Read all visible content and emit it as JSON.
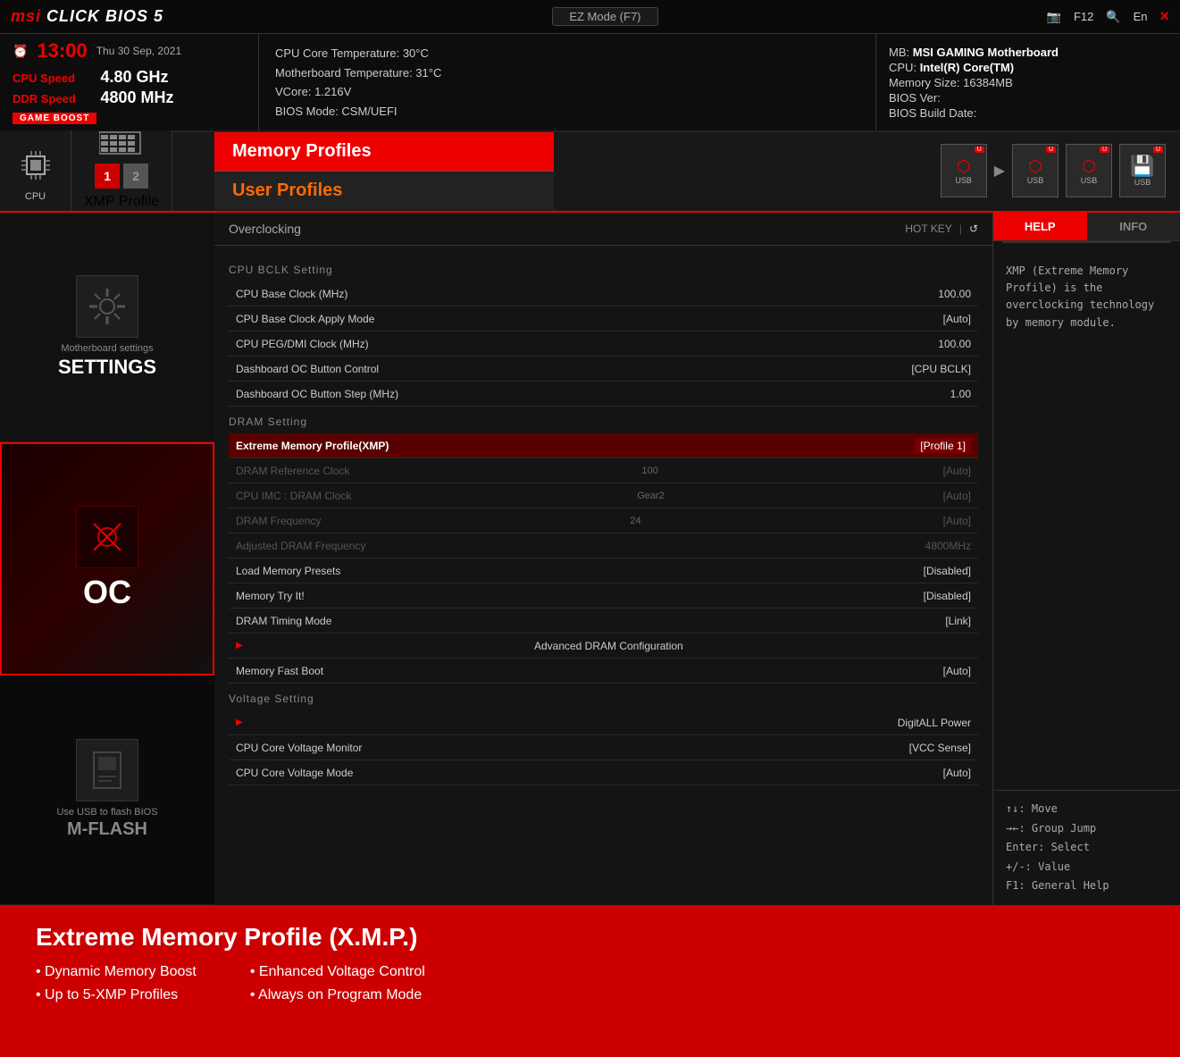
{
  "topbar": {
    "logo": "MSI CLICK BIOS 5",
    "ez_mode": "EZ Mode (F7)",
    "f12": "F12",
    "lang": "En",
    "close": "×"
  },
  "infobar": {
    "clock_symbol": "⏰",
    "time": "13:00",
    "date": "Thu 30 Sep, 2021",
    "cpu_speed_label": "CPU Speed",
    "cpu_speed_val": "4.80 GHz",
    "ddr_speed_label": "DDR Speed",
    "ddr_speed_val": "4800 MHz",
    "game_boost": "GAME BOOST",
    "mid": [
      "CPU Core Temperature: 30°C",
      "Motherboard Temperature: 31°C",
      "VCore: 1.216V",
      "BIOS Mode: CSM/UEFI"
    ],
    "right": {
      "mb_label": "MB:",
      "mb_val": "MSI GAMING Motherboard",
      "cpu_label": "CPU:",
      "cpu_val": "Intel(R) Core(TM)",
      "mem_label": "Memory Size:",
      "mem_val": "16384MB",
      "bios_ver_label": "BIOS Ver:",
      "bios_ver_val": "",
      "bios_build_label": "BIOS Build Date:",
      "bios_build_val": ""
    }
  },
  "nav": {
    "tabs": [
      {
        "id": "cpu",
        "icon": "🖥",
        "label": "CPU"
      },
      {
        "id": "xmp",
        "icon": "▦",
        "label": "XMP Profile"
      }
    ],
    "xmp_nums": [
      "1",
      "2"
    ],
    "memory_profiles_label": "Memory Profiles",
    "user_profiles_label": "User Profiles",
    "usb_icons": [
      "USB",
      "USB",
      "USB",
      "USB"
    ]
  },
  "sidebar": {
    "settings": {
      "sublabel": "Motherboard settings",
      "main_label": "SETTINGS"
    },
    "oc": {
      "main_label": "OC",
      "usb_label": "Use USB to flash BIOS",
      "mflash_label": "M-FLASH"
    }
  },
  "oc_page": {
    "title": "Overclocking",
    "hotkey_label": "HOT KEY",
    "hotkey_pipe": "|",
    "undo_symbol": "↺",
    "sections": {
      "cpu_bclk": {
        "header": "CPU BCLK Setting",
        "rows": [
          {
            "label": "CPU Base Clock (MHz)",
            "val": "100.00",
            "dimmed": false,
            "highlighted": false
          },
          {
            "label": "CPU Base Clock Apply Mode",
            "val": "[Auto]",
            "dimmed": false,
            "highlighted": false
          },
          {
            "label": "CPU PEG/DMI Clock (MHz)",
            "val": "100.00",
            "dimmed": false,
            "highlighted": false
          },
          {
            "label": "Dashboard OC Button Control",
            "val": "[CPU BCLK]",
            "dimmed": false,
            "highlighted": false
          },
          {
            "label": "Dashboard OC Button Step (MHz)",
            "val": "1.00",
            "dimmed": false,
            "highlighted": false
          }
        ]
      },
      "dram": {
        "header": "DRAM Setting",
        "rows": [
          {
            "label": "Extreme Memory Profile(XMP)",
            "val": "[Profile 1]",
            "dimmed": false,
            "highlighted": true
          },
          {
            "label": "DRAM Reference Clock",
            "sub": "100",
            "val": "[Auto]",
            "dimmed": true,
            "highlighted": false
          },
          {
            "label": "CPU IMC : DRAM Clock",
            "sub": "Gear2",
            "val": "[Auto]",
            "dimmed": true,
            "highlighted": false
          },
          {
            "label": "DRAM Frequency",
            "sub": "24",
            "val": "[Auto]",
            "dimmed": true,
            "highlighted": false
          },
          {
            "label": "Adjusted DRAM Frequency",
            "sub": "",
            "val": "4800MHz",
            "dimmed": true,
            "highlighted": false
          },
          {
            "label": "Load Memory Presets",
            "val": "[Disabled]",
            "dimmed": false,
            "highlighted": false
          },
          {
            "label": "Memory Try It!",
            "val": "[Disabled]",
            "dimmed": false,
            "highlighted": false
          },
          {
            "label": "DRAM Timing Mode",
            "val": "[Link]",
            "dimmed": false,
            "highlighted": false
          },
          {
            "label": "Advanced DRAM Configuration",
            "val": "",
            "has_arrow": true,
            "dimmed": false,
            "highlighted": false
          },
          {
            "label": "Memory Fast Boot",
            "val": "[Auto]",
            "dimmed": false,
            "highlighted": false
          }
        ]
      },
      "voltage": {
        "header": "Voltage Setting",
        "rows": [
          {
            "label": "DigitALL Power",
            "val": "",
            "has_arrow": true,
            "dimmed": false,
            "highlighted": false
          },
          {
            "label": "CPU Core Voltage Monitor",
            "val": "[VCC Sense]",
            "dimmed": false,
            "highlighted": false
          },
          {
            "label": "CPU Core Voltage Mode",
            "val": "[Auto]",
            "dimmed": false,
            "highlighted": false
          }
        ]
      }
    }
  },
  "help": {
    "tab_help": "HELP",
    "tab_info": "INFO",
    "content": "XMP (Extreme Memory Profile) is the overclocking technology by memory module.",
    "keys": [
      "↑↓: Move",
      "→←: Group Jump",
      "Enter: Select",
      "+/-: Value",
      "F1: General Help"
    ]
  },
  "bottom": {
    "title": "Extreme Memory Profile (X.M.P.)",
    "features_left": [
      "• Dynamic Memory Boost",
      "• Up to 5-XMP Profiles"
    ],
    "features_right": [
      "• Enhanced Voltage Control",
      "• Always on Program Mode"
    ]
  }
}
